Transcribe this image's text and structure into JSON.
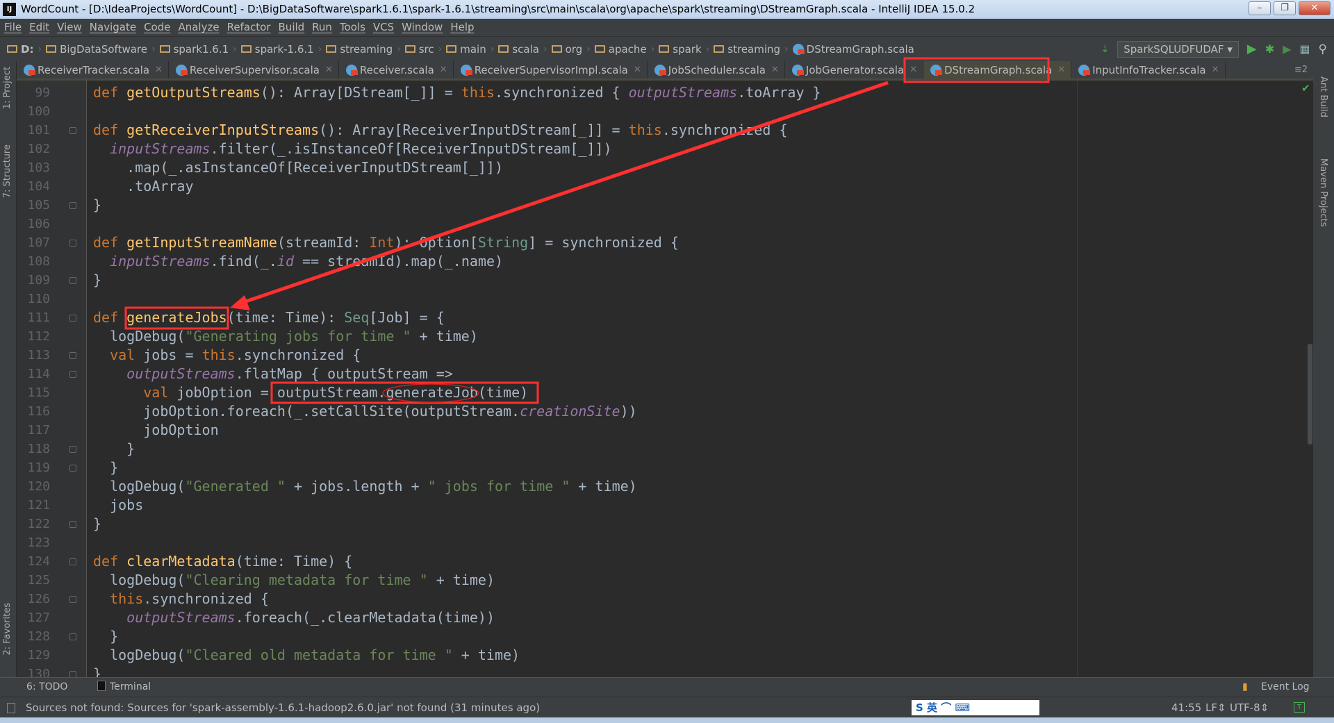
{
  "window": {
    "title": "WordCount - [D:\\IdeaProjects\\WordCount] - D:\\BigDataSoftware\\spark1.6.1\\spark-1.6.1\\streaming\\src\\main\\scala\\org\\apache\\spark\\streaming\\DStreamGraph.scala - IntelliJ IDEA 15.0.2",
    "app_icon": "IJ",
    "minimize": "–",
    "restore": "❐",
    "close": "✕"
  },
  "menu": [
    "File",
    "Edit",
    "View",
    "Navigate",
    "Code",
    "Analyze",
    "Refactor",
    "Build",
    "Run",
    "Tools",
    "VCS",
    "Window",
    "Help"
  ],
  "breadcrumbs": [
    "D:",
    "BigDataSoftware",
    "spark1.6.1",
    "spark-1.6.1",
    "streaming",
    "src",
    "main",
    "scala",
    "org",
    "apache",
    "spark",
    "streaming",
    "DStreamGraph.scala"
  ],
  "toolbar": {
    "run_config": "SparkSQLUDFUDAF",
    "run_icon": "play-icon",
    "debug_icon": "bug-icon",
    "search_icon": "search-icon"
  },
  "tabs": [
    {
      "label": "ReceiverTracker.scala"
    },
    {
      "label": "ReceiverSupervisor.scala"
    },
    {
      "label": "Receiver.scala"
    },
    {
      "label": "ReceiverSupervisorImpl.scala"
    },
    {
      "label": "JobScheduler.scala"
    },
    {
      "label": "JobGenerator.scala"
    },
    {
      "label": "DStreamGraph.scala",
      "active": true
    },
    {
      "label": "InputInfoTracker.scala"
    }
  ],
  "tab_overflow": "≡2",
  "left_tools": [
    "1: Project",
    "7: Structure",
    "2: Favorites"
  ],
  "right_tools": [
    "Ant Build",
    "Maven Projects"
  ],
  "colors": {
    "keyword": "#cc7832",
    "function": "#ffc66d",
    "field": "#9876aa",
    "string": "#6a8759",
    "text": "#a9b7c6",
    "annotation": "#ff3030"
  },
  "editor": {
    "lines": [
      {
        "n": "99",
        "t": [
          [
            "k",
            "def "
          ],
          [
            "f",
            "getOutputStreams"
          ],
          [
            "n",
            "(): Array[DStream[_]] = "
          ],
          [
            "k",
            "this"
          ],
          [
            "n",
            ".synchronized { "
          ],
          [
            "v",
            "outputStreams"
          ],
          [
            "n",
            ".toArray }"
          ]
        ]
      },
      {
        "n": "100",
        "t": []
      },
      {
        "n": "101",
        "t": [
          [
            "k",
            "def "
          ],
          [
            "f",
            "getReceiverInputStreams"
          ],
          [
            "n",
            "(): Array[ReceiverInputDStream[_]] = "
          ],
          [
            "k",
            "this"
          ],
          [
            "n",
            ".synchronized {"
          ]
        ]
      },
      {
        "n": "102",
        "t": [
          [
            "n",
            "  "
          ],
          [
            "v",
            "inputStreams"
          ],
          [
            "n",
            ".filter(_.isInstanceOf[ReceiverInputDStream[_]])"
          ]
        ]
      },
      {
        "n": "103",
        "t": [
          [
            "n",
            "    .map(_.asInstanceOf[ReceiverInputDStream[_]])"
          ]
        ]
      },
      {
        "n": "104",
        "t": [
          [
            "n",
            "    .toArray"
          ]
        ]
      },
      {
        "n": "105",
        "t": [
          [
            "n",
            "}"
          ]
        ]
      },
      {
        "n": "106",
        "t": []
      },
      {
        "n": "107",
        "t": [
          [
            "k",
            "def "
          ],
          [
            "f",
            "getInputStreamName"
          ],
          [
            "n",
            "(streamId: "
          ],
          [
            "o",
            "Int"
          ],
          [
            "n",
            "): Option["
          ],
          [
            "t",
            "String"
          ],
          [
            "n",
            "] = synchronized {"
          ]
        ]
      },
      {
        "n": "108",
        "t": [
          [
            "n",
            "  "
          ],
          [
            "v",
            "inputStreams"
          ],
          [
            "n",
            ".find(_."
          ],
          [
            "v",
            "id"
          ],
          [
            "n",
            " == streamId).map(_.name)"
          ]
        ]
      },
      {
        "n": "109",
        "t": [
          [
            "n",
            "}"
          ]
        ]
      },
      {
        "n": "110",
        "t": []
      },
      {
        "n": "111",
        "t": [
          [
            "k",
            "def "
          ],
          [
            "f",
            "generateJobs"
          ],
          [
            "n",
            "(time: Time): "
          ],
          [
            "t",
            "Seq"
          ],
          [
            "n",
            "[Job] = {"
          ]
        ]
      },
      {
        "n": "112",
        "t": [
          [
            "n",
            "  logDebug("
          ],
          [
            "s",
            "\"Generating jobs for time \""
          ],
          [
            "n",
            " + time)"
          ]
        ]
      },
      {
        "n": "113",
        "t": [
          [
            "n",
            "  "
          ],
          [
            "k",
            "val "
          ],
          [
            "n",
            "jobs = "
          ],
          [
            "k",
            "this"
          ],
          [
            "n",
            ".synchronized {"
          ]
        ]
      },
      {
        "n": "114",
        "t": [
          [
            "n",
            "    "
          ],
          [
            "v",
            "outputStreams"
          ],
          [
            "n",
            ".flatMap { outputStream =>"
          ]
        ]
      },
      {
        "n": "115",
        "t": [
          [
            "n",
            "      "
          ],
          [
            "k",
            "val "
          ],
          [
            "n",
            "jobOption = outputStream.generateJob(time)"
          ]
        ]
      },
      {
        "n": "116",
        "t": [
          [
            "n",
            "      jobOption.foreach(_.setCallSite(outputStream."
          ],
          [
            "v",
            "creationSite"
          ],
          [
            "n",
            "))"
          ]
        ]
      },
      {
        "n": "117",
        "t": [
          [
            "n",
            "      jobOption"
          ]
        ]
      },
      {
        "n": "118",
        "t": [
          [
            "n",
            "    }"
          ]
        ]
      },
      {
        "n": "119",
        "t": [
          [
            "n",
            "  }"
          ]
        ]
      },
      {
        "n": "120",
        "t": [
          [
            "n",
            "  logDebug("
          ],
          [
            "s",
            "\"Generated \""
          ],
          [
            "n",
            " + jobs.length + "
          ],
          [
            "s",
            "\" jobs for time \""
          ],
          [
            "n",
            " + time)"
          ]
        ]
      },
      {
        "n": "121",
        "t": [
          [
            "n",
            "  jobs"
          ]
        ]
      },
      {
        "n": "122",
        "t": [
          [
            "n",
            "}"
          ]
        ]
      },
      {
        "n": "123",
        "t": []
      },
      {
        "n": "124",
        "t": [
          [
            "k",
            "def "
          ],
          [
            "f",
            "clearMetadata"
          ],
          [
            "n",
            "(time: Time) {"
          ]
        ]
      },
      {
        "n": "125",
        "t": [
          [
            "n",
            "  logDebug("
          ],
          [
            "s",
            "\"Clearing metadata for time \""
          ],
          [
            "n",
            " + time)"
          ]
        ]
      },
      {
        "n": "126",
        "t": [
          [
            "n",
            "  "
          ],
          [
            "k",
            "this"
          ],
          [
            "n",
            ".synchronized {"
          ]
        ]
      },
      {
        "n": "127",
        "t": [
          [
            "n",
            "    "
          ],
          [
            "v",
            "outputStreams"
          ],
          [
            "n",
            ".foreach(_.clearMetadata(time))"
          ]
        ]
      },
      {
        "n": "128",
        "t": [
          [
            "n",
            "  }"
          ]
        ]
      },
      {
        "n": "129",
        "t": [
          [
            "n",
            "  logDebug("
          ],
          [
            "s",
            "\"Cleared old metadata for time \""
          ],
          [
            "n",
            " + time)"
          ]
        ]
      },
      {
        "n": "130",
        "t": [
          [
            "n",
            "}"
          ]
        ]
      }
    ],
    "folds": [
      "101",
      "105",
      "107",
      "109",
      "111",
      "113",
      "114",
      "118",
      "119",
      "122",
      "124",
      "126",
      "128",
      "130"
    ]
  },
  "bottom_tools": {
    "todo": "6: TODO",
    "terminal": "Terminal",
    "event_log": "Event Log"
  },
  "status": {
    "message": "Sources not found: Sources for 'spark-assembly-1.6.1-hadoop2.6.0.jar' not found (31 minutes ago)",
    "position": "41:55",
    "line_sep": "LF⇕",
    "encoding": "UTF-8⇕",
    "ime": "S 英 ⌒ ⌨"
  }
}
